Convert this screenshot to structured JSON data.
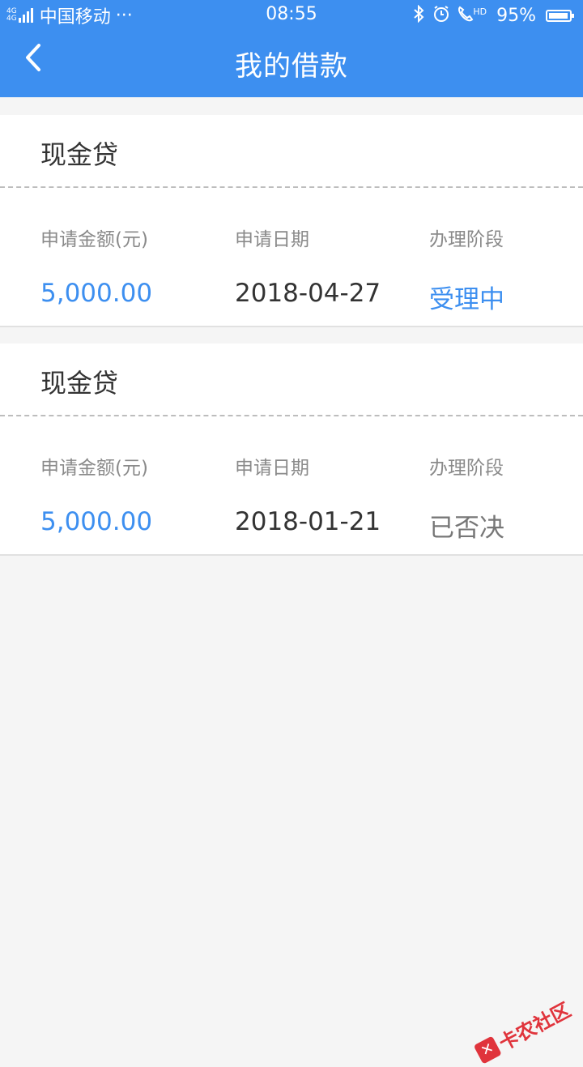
{
  "status_bar": {
    "network_badges": [
      "4G",
      "4G"
    ],
    "carrier": "中国移动",
    "more": "···",
    "time": "08:55",
    "hd": "HD",
    "battery_percent": "95%",
    "battery_level": 0.95
  },
  "header": {
    "title": "我的借款",
    "background": "#3d8ff0"
  },
  "loans": [
    {
      "product": "现金贷",
      "amount_label": "申请金额(元)",
      "date_label": "申请日期",
      "stage_label": "办理阶段",
      "amount": "5,000.00",
      "date": "2018-04-27",
      "stage": "受理中",
      "stage_color": "#3d8ff0"
    },
    {
      "product": "现金贷",
      "amount_label": "申请金额(元)",
      "date_label": "申请日期",
      "stage_label": "办理阶段",
      "amount": "5,000.00",
      "date": "2018-01-21",
      "stage": "已否决",
      "stage_color": "#777777"
    }
  ],
  "watermark": {
    "text": "卡农社区",
    "color": "#e0343c"
  }
}
